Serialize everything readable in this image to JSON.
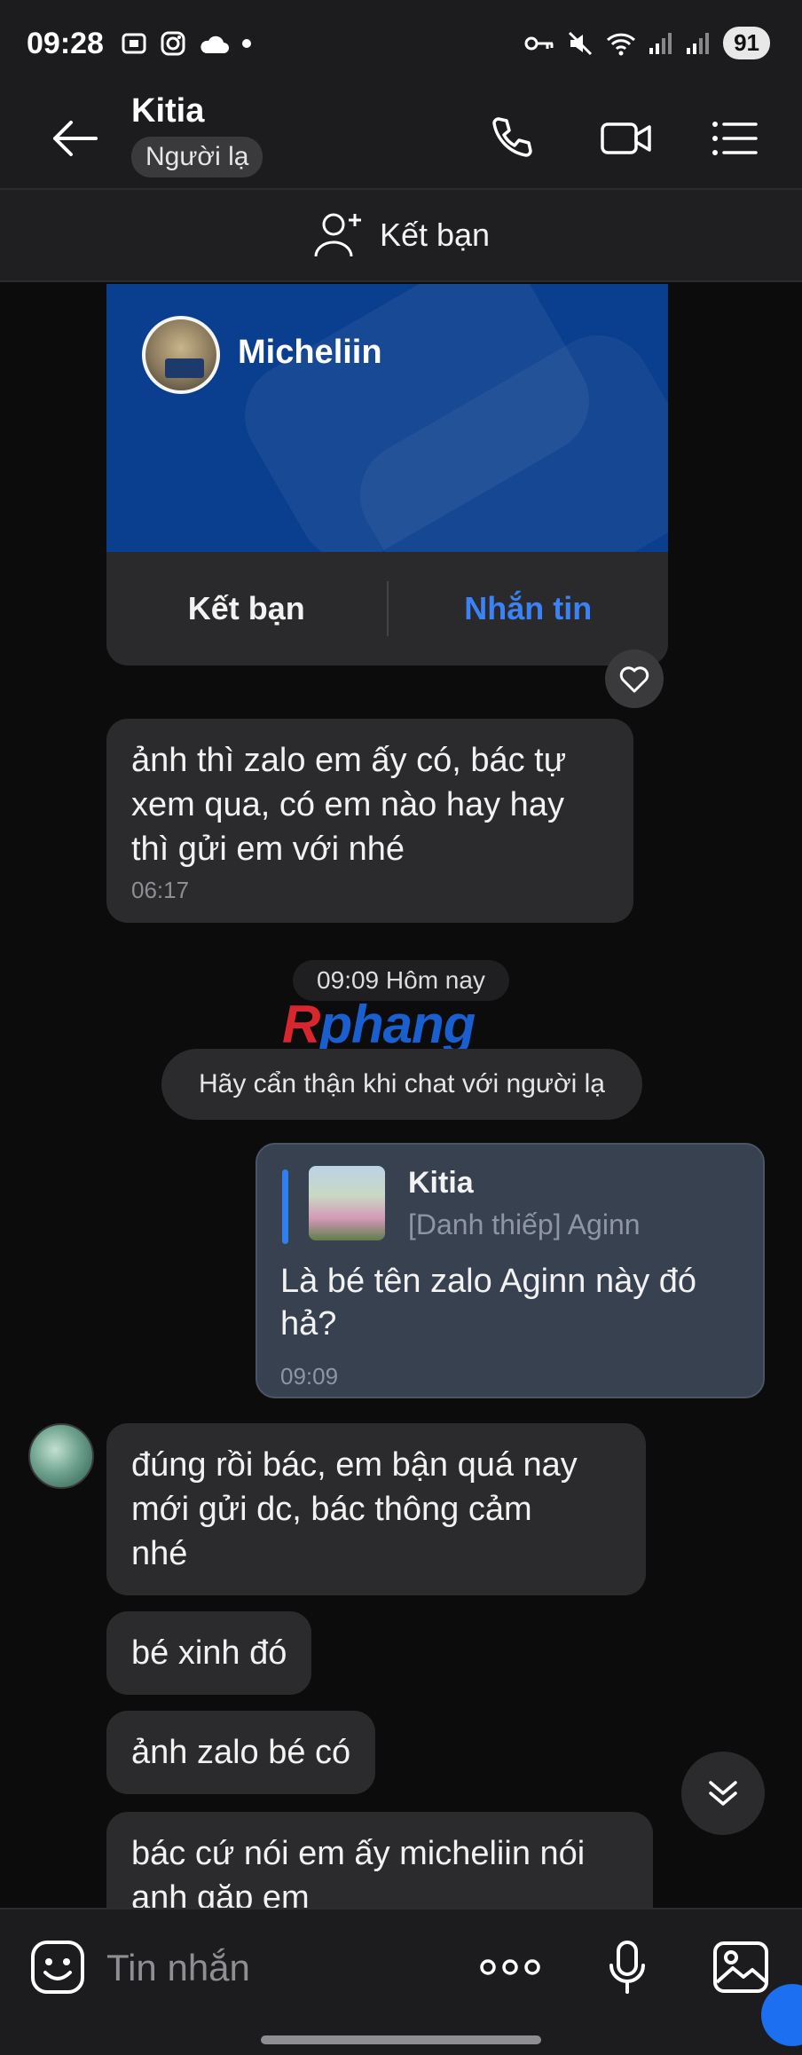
{
  "status_bar": {
    "time": "09:28",
    "battery": "91"
  },
  "header": {
    "contact_name": "Kitia",
    "stranger_badge": "Người lạ"
  },
  "add_friend_bar": {
    "label": "Kết bạn"
  },
  "profile_card": {
    "name": "Micheliin",
    "add_friend_label": "Kết bạn",
    "message_label": "Nhắn tin"
  },
  "messages": [
    {
      "lines": [
        "ảnh thì zalo em ấy có, bác tự",
        "xem qua, có em nào hay hay",
        "thì gửi em với nhé"
      ],
      "time": "06:17"
    }
  ],
  "date_separator": "09:09 Hôm nay",
  "watermark": {
    "first": "R",
    "rest": "phang"
  },
  "warning": "Hãy cẩn thận khi chat với người lạ",
  "sent_message": {
    "quote_name": "Kitia",
    "quote_text": "[Danh thiếp] Aginn",
    "lines": [
      "Là bé tên zalo Aginn này đó",
      "hả?"
    ],
    "time": "09:09"
  },
  "peer_messages": [
    {
      "lines": [
        "đúng rồi bác, em bận quá nay",
        "mới gửi dc, bác thông cảm",
        "nhé"
      ]
    },
    {
      "lines": [
        "bé xinh đó"
      ]
    },
    {
      "lines": [
        "ảnh zalo bé có"
      ]
    },
    {
      "lines": [
        "bác cứ nói em ấy micheliin nói",
        "anh gặp em"
      ]
    }
  ],
  "input_bar": {
    "placeholder": "Tin nhắn"
  },
  "icons": {
    "back": "arrow-left-icon",
    "call": "phone-icon",
    "video": "video-camera-icon",
    "menu": "list-menu-icon",
    "add_friend": "user-plus-icon",
    "heart": "heart-icon",
    "scroll_down": "double-chevron-down-icon",
    "sticker": "sticker-face-icon",
    "more": "more-dots-icon",
    "mic": "microphone-icon",
    "image": "image-icon"
  },
  "colors": {
    "accent_blue": "#3b82f6",
    "card_blue": "#0a3e8e",
    "sent_bubble": "#374150",
    "received_bubble": "#2b2b2d",
    "background": "#0c0c0d"
  }
}
